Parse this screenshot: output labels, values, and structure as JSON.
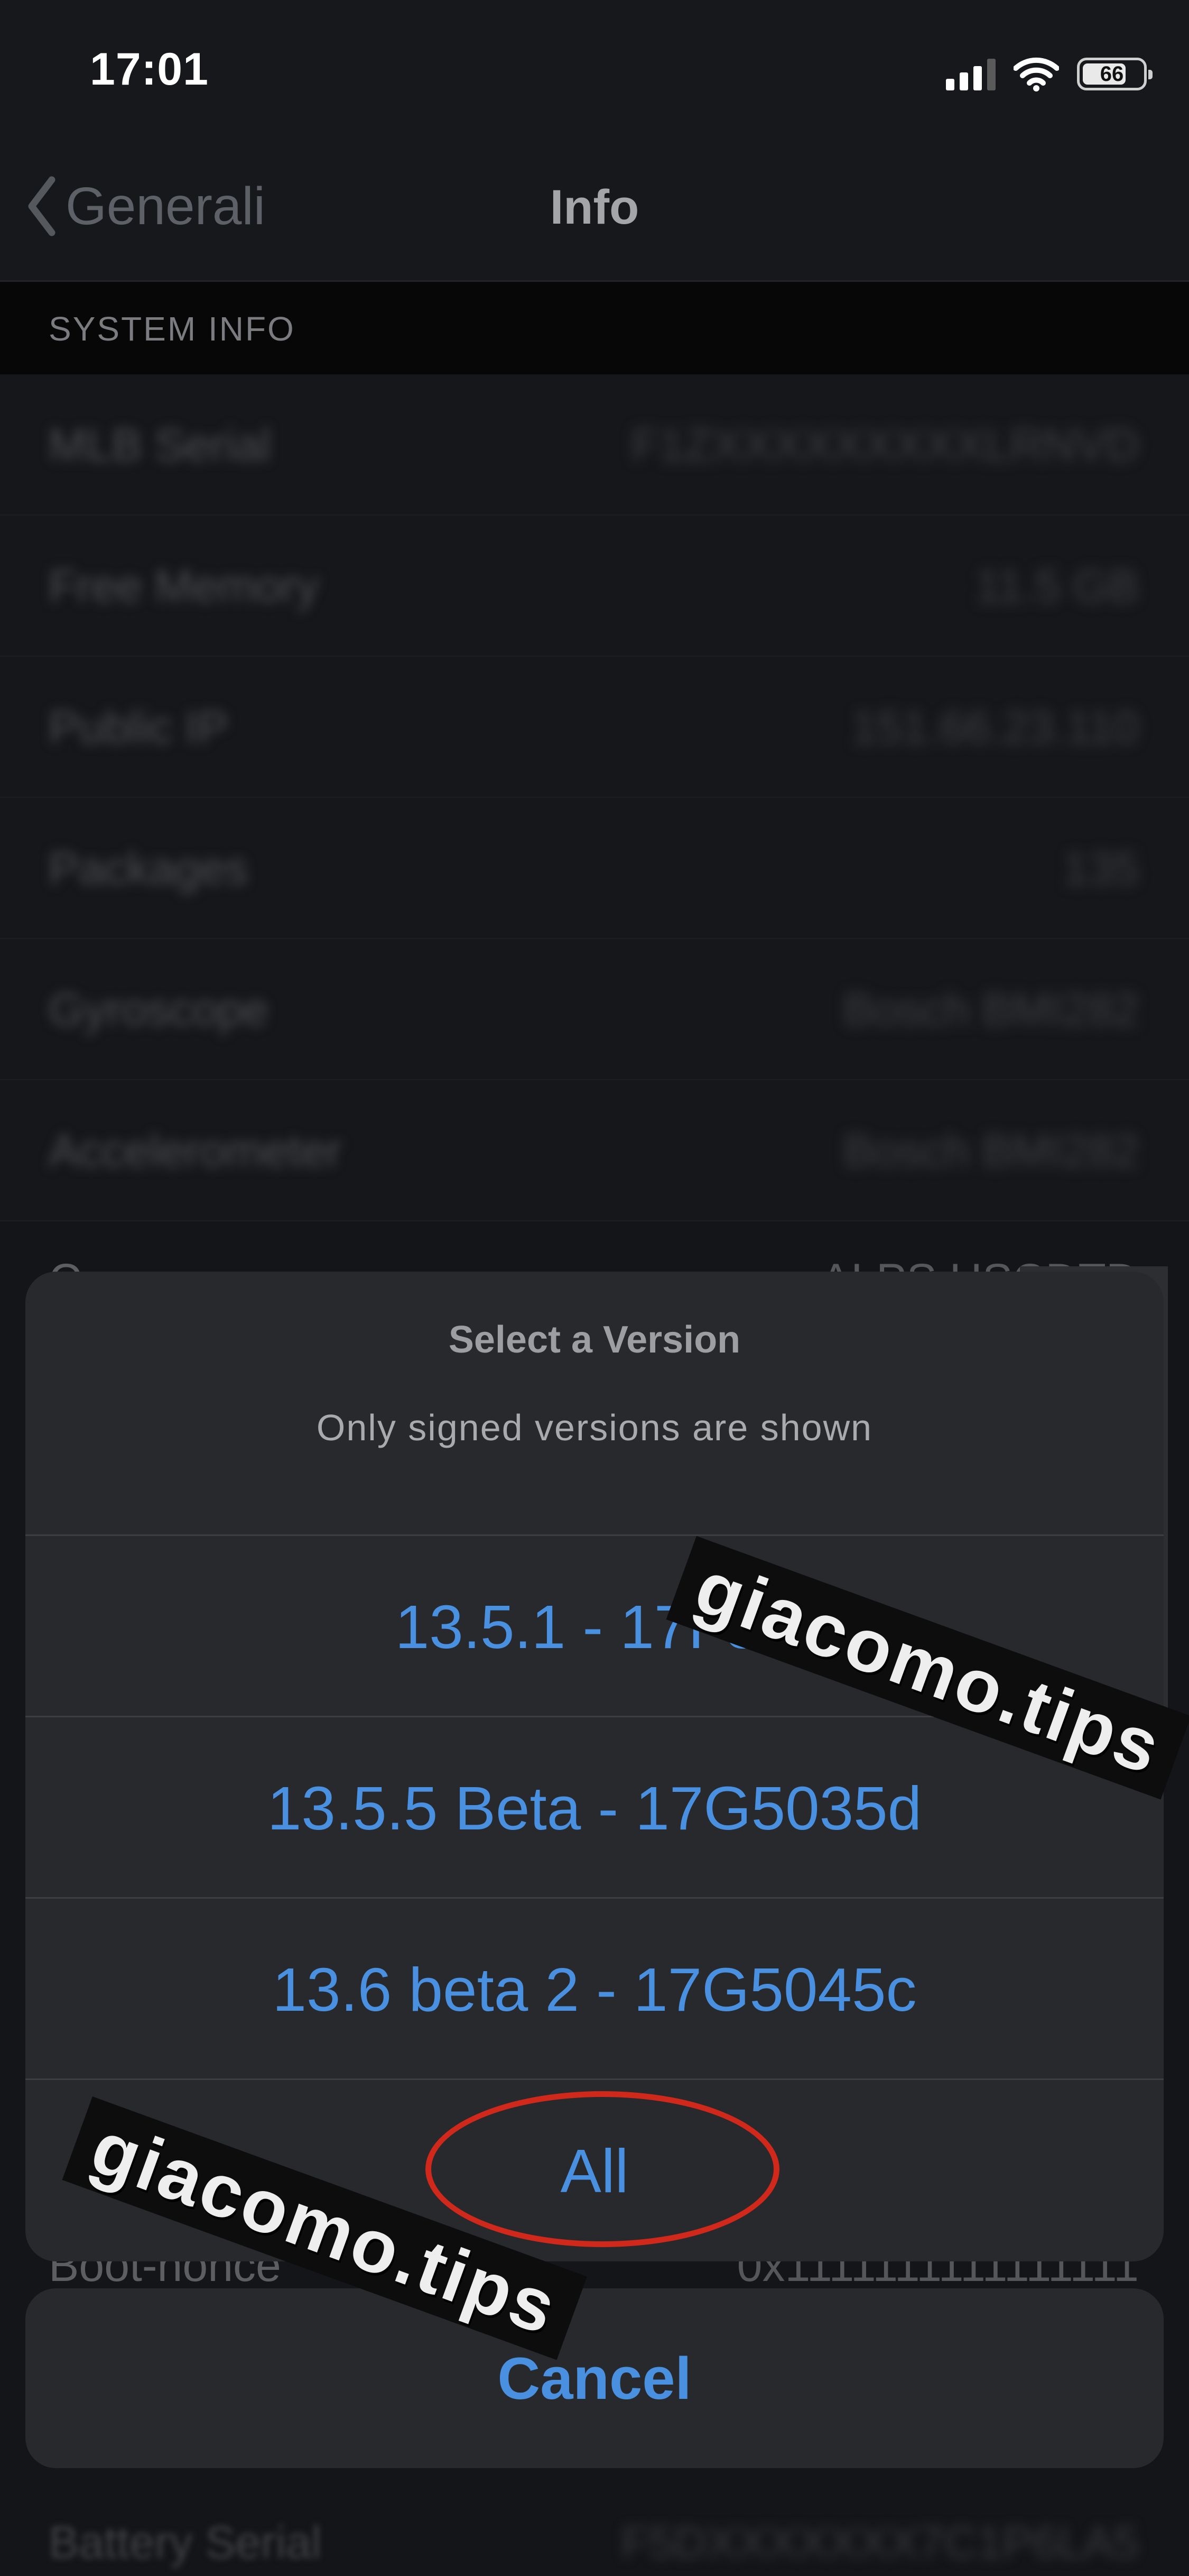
{
  "status_bar": {
    "time": "17:01",
    "battery": "66",
    "icons": [
      "signal-icon",
      "wifi-icon",
      "battery-icon"
    ]
  },
  "nav": {
    "back_label": "Generali",
    "title": "Info"
  },
  "section": {
    "header": "SYSTEM INFO"
  },
  "info_rows": [
    {
      "label": "MLB Serial",
      "value": "F1ZXXXXXXXXXLRNVD"
    },
    {
      "label": "Free Memory",
      "value": "11.5 GB"
    },
    {
      "label": "Public IP",
      "value": "151.66.23.110"
    },
    {
      "label": "Packages",
      "value": "135"
    },
    {
      "label": "Gyroscope",
      "value": "Bosch BMI282"
    },
    {
      "label": "Accelerometer",
      "value": "Bosch BMI282"
    }
  ],
  "peek_rows": {
    "top": {
      "label": "C",
      "value": "ALPS HSCDTD"
    },
    "bottom": {
      "label": "Boot-nonce",
      "value": "0x1111111111111111"
    },
    "last": {
      "label": "Battery Serial",
      "value": "F5DXXXXXXX7C1P6LA5"
    }
  },
  "sheet": {
    "title": "Select a Version",
    "subtitle": "Only signed versions are shown",
    "options": [
      {
        "label": "13.5.1 - 17F80"
      },
      {
        "label": "13.5.5 Beta - 17G5035d"
      },
      {
        "label": "13.6 beta 2 - 17G5045c"
      },
      {
        "label": "All"
      }
    ],
    "cancel_label": "Cancel"
  },
  "watermark": {
    "text_1": "giacomo.tips",
    "text_2": "giacomo.tips"
  },
  "colors": {
    "accent": "#4a90e0",
    "highlight": "#d0281a",
    "sheet_bg": "#27292c"
  }
}
